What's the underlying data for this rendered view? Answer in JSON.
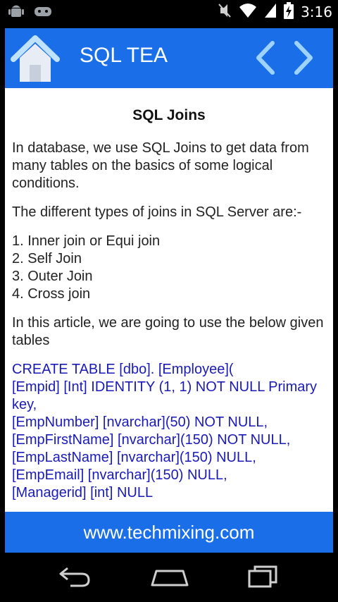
{
  "status": {
    "time": "3:16"
  },
  "header": {
    "title": "SQL TEA"
  },
  "article": {
    "title": "SQL Joins",
    "intro": "In database, we use SQL Joins to get data from many tables on the basics of some logical conditions.",
    "types_intro": "The different types of joins in SQL Server are:-",
    "join_types": [
      "1. Inner join or Equi join",
      "2. Self Join",
      "3. Outer Join",
      "4. Cross join"
    ],
    "tables_intro": "In this article, we are going to use the below given tables",
    "code_lines": [
      "CREATE TABLE [dbo]. [Employee](",
      "[Empid] [Int] IDENTITY (1, 1) NOT NULL Primary key,",
      "[EmpNumber] [nvarchar](50) NOT NULL,",
      "[EmpFirstName] [nvarchar](150) NOT NULL,",
      "[EmpLastName] [nvarchar](150) NULL,",
      "[EmpEmail] [nvarchar](150) NULL,",
      "[Managerid] [int] NULL"
    ]
  },
  "footer": {
    "text": "www.techmixing.com"
  },
  "colors": {
    "brand": "#1a6fe8",
    "code": "#1a1ab8"
  }
}
